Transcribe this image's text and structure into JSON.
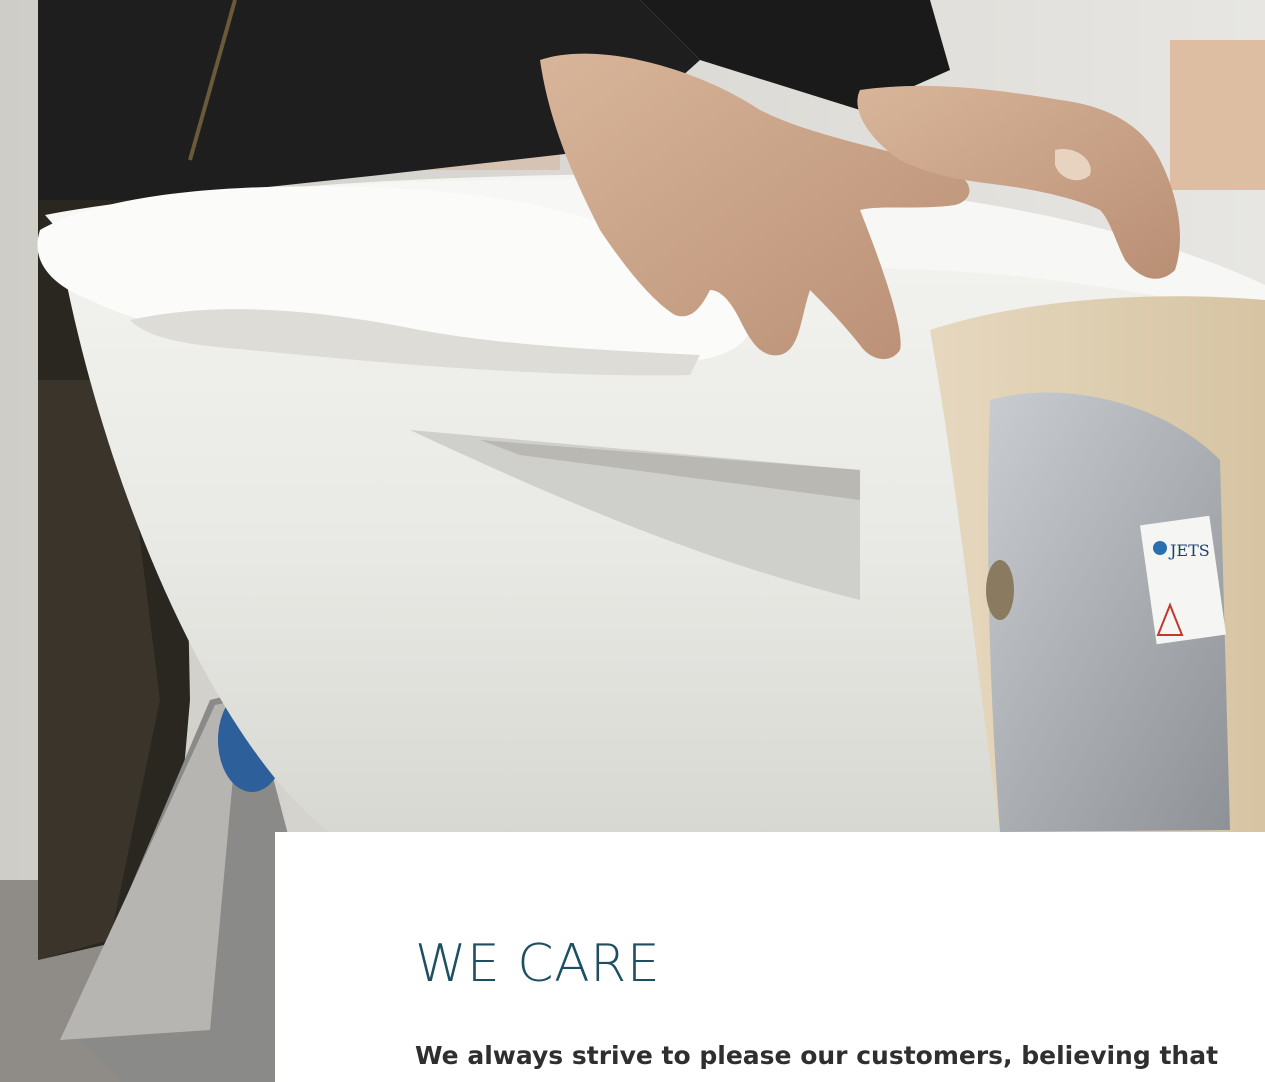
{
  "section": {
    "heading": "WE CARE",
    "body": "We always strive to please our customers, believing that"
  },
  "hero_image": {
    "subject": "hands unpacking a white ceramic toilet bowl",
    "label_logo_text": "JETS"
  },
  "colors": {
    "heading": "#1b4f61",
    "body_text": "#2f2f2f",
    "card_background": "#ffffff"
  }
}
